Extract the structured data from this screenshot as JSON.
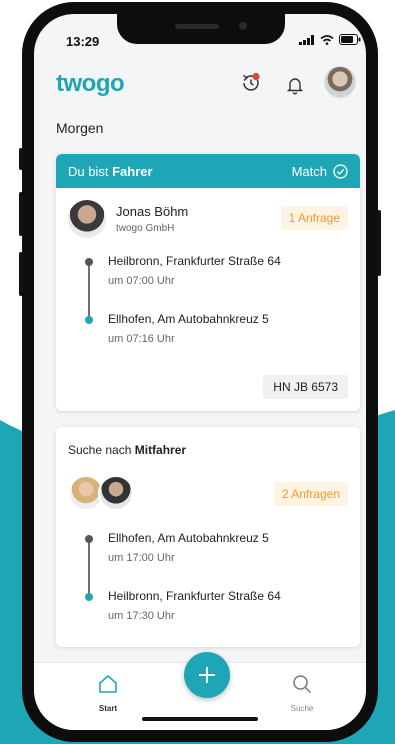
{
  "status_bar": {
    "time": "13:29"
  },
  "header": {
    "logo": "twogo"
  },
  "icons": {
    "history": "history-icon",
    "notifications": "bell-icon",
    "profile": "avatar",
    "home": "home-icon",
    "search": "search-icon",
    "add": "plus-icon",
    "check": "check-circle-icon"
  },
  "colors": {
    "accent": "#1fa6b6",
    "badge_text": "#f39a2e",
    "badge_bg": "#fff3e4",
    "notification_dot": "#e0463b"
  },
  "day_label": "Morgen",
  "ride_card": {
    "role_prefix": "Du bist",
    "role": "Fahrer",
    "status": "Match",
    "driver_name": "Jonas Böhm",
    "company": "twogo GmbH",
    "requests_badge": "1 Anfrage",
    "stops": [
      {
        "address": "Heilbronn, Frankfurter Straße 64",
        "time": "um 07:00 Uhr"
      },
      {
        "address": "Ellhofen, Am Autobahnkreuz 5",
        "time": "um 07:16 Uhr"
      }
    ],
    "license_plate": "HN JB 6573"
  },
  "search_card": {
    "title_prefix": "Suche nach",
    "title": "Mitfahrer",
    "requests_badge": "2 Anfragen",
    "stops": [
      {
        "address": "Ellhofen, Am Autobahnkreuz 5",
        "time": "um 17:00 Uhr"
      },
      {
        "address": "Heilbronn, Frankfurter Straße 64",
        "time": "um 17:30 Uhr"
      }
    ]
  },
  "tabbar": {
    "start": "Start",
    "search": "Suche"
  }
}
